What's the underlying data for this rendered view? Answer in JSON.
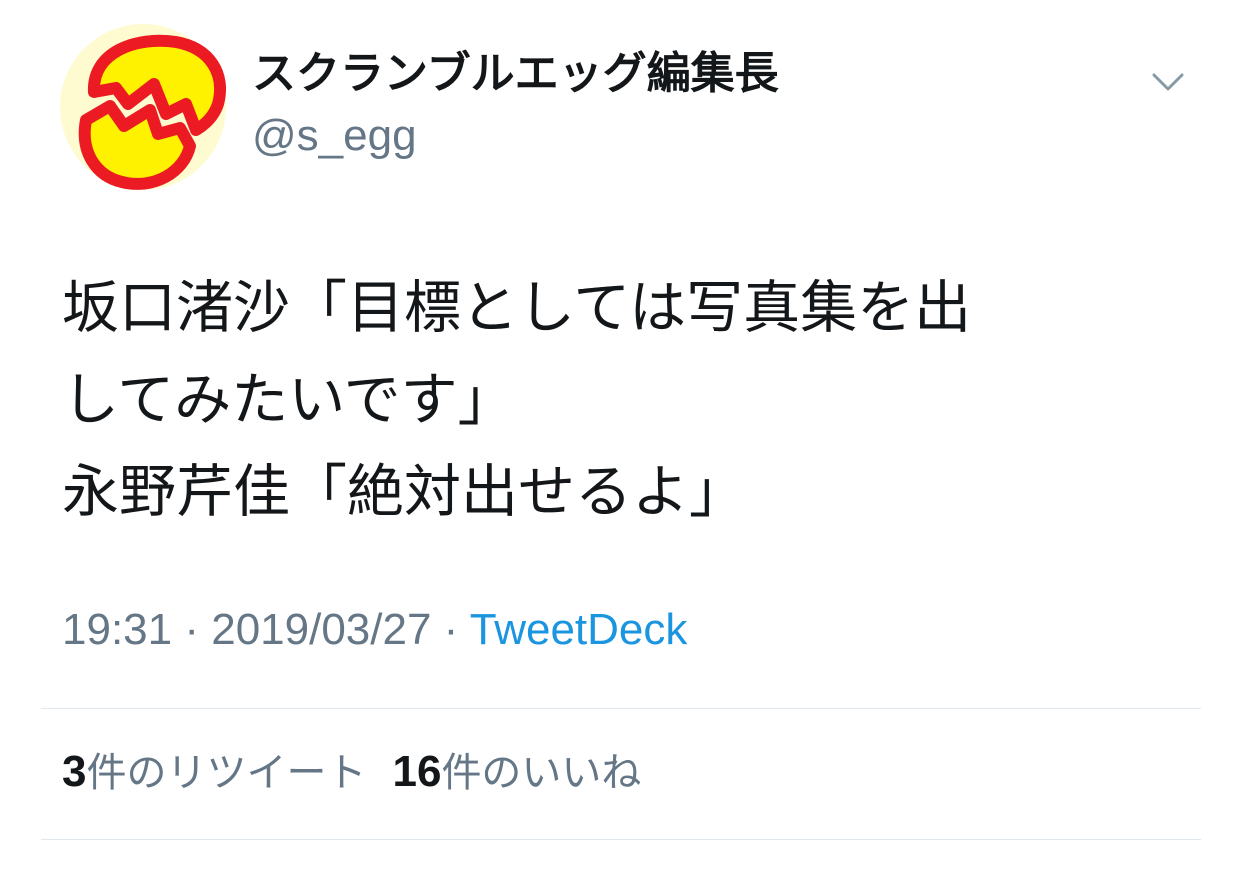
{
  "tweet": {
    "author": {
      "name": "スクランブルエッグ編集長",
      "handle": "@s_egg",
      "avatar_icon": "cracked-egg-icon"
    },
    "menu_icon": "chevron-down-icon",
    "text_lines": [
      "坂口渚沙「目標としては写真集を出",
      "してみたいです」",
      "永野芹佳「絶対出せるよ」"
    ],
    "time": "19:31",
    "date": "2019/03/27",
    "separator": " · ",
    "source": "TweetDeck",
    "retweets": {
      "count": "3",
      "label": "件のリツイート"
    },
    "likes": {
      "count": "16",
      "label": "件のいいね"
    }
  },
  "colors": {
    "text": "#14171a",
    "secondary": "#657786",
    "link": "#1b95e0",
    "divider": "#e1e8ed",
    "avatar_bg": "#fdfbcf",
    "egg_red": "#ec1b23",
    "egg_yellow": "#fff200"
  }
}
